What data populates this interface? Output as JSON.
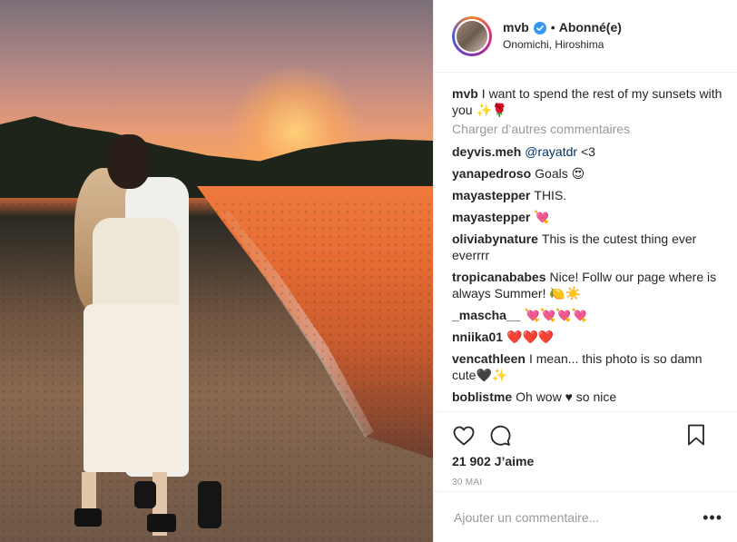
{
  "header": {
    "username": "mvb",
    "follow_status": "Abonné(e)",
    "location": "Onomichi, Hiroshima",
    "separator": "•"
  },
  "caption": {
    "user": "mvb",
    "text": "I want to spend the rest of my sunsets with you ✨🌹"
  },
  "load_more_label": "Charger d’autres commentaires",
  "comments": [
    {
      "user": "deyvis.meh",
      "text": "<3",
      "mention": "@rayatdr"
    },
    {
      "user": "yanapedroso",
      "text": "Goals 😍"
    },
    {
      "user": "mayastepper",
      "text": "THIS."
    },
    {
      "user": "mayastepper",
      "text": "💘"
    },
    {
      "user": "oliviabynature",
      "text": "This is the cutest thing ever everrrr"
    },
    {
      "user": "tropicanababes",
      "text": "Nice! Follw our page where is always Summer! 🍋☀️"
    },
    {
      "user": "_mascha__",
      "text": "💘💘💘💘"
    },
    {
      "user": "nniika01",
      "text": "❤️❤️❤️"
    },
    {
      "user": "vencathleen",
      "text": "I mean... this photo is so damn cute🖤✨"
    },
    {
      "user": "boblistme",
      "text": "Oh wow ♥ so nice"
    }
  ],
  "actions": {
    "likes": "21 902 J’aime",
    "date": "30 MAI"
  },
  "add_comment": {
    "placeholder": "Ajouter un commentaire...",
    "more": "•••"
  },
  "colors": {
    "verified_blue": "#3897f0",
    "muted_text": "#999999",
    "mention": "#003569"
  },
  "icons": {
    "like": "heart-outline-icon",
    "comment": "comment-bubble-icon",
    "save": "bookmark-icon",
    "verified": "verified-badge-icon"
  }
}
